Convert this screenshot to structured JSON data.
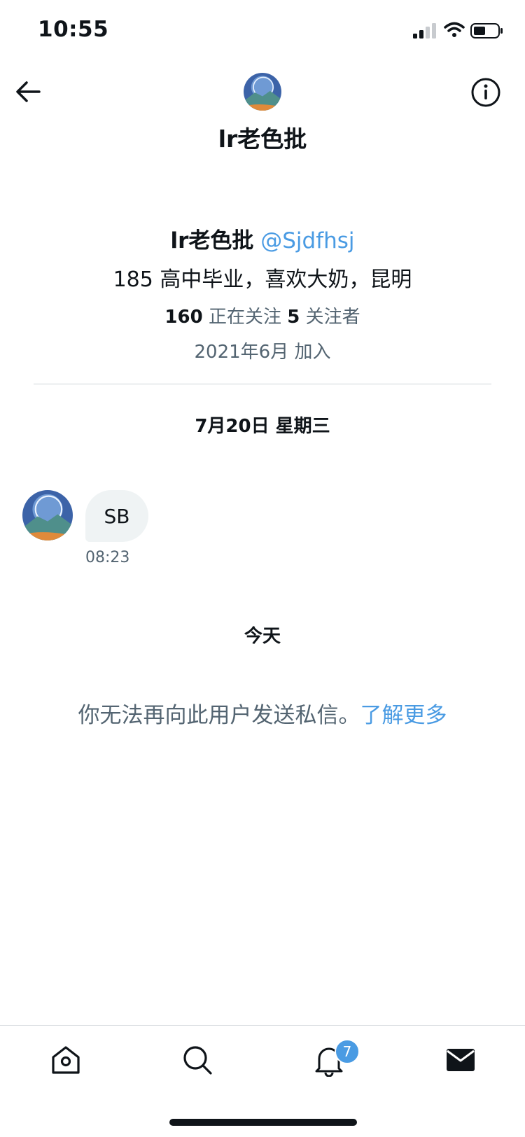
{
  "status_bar": {
    "time": "10:55"
  },
  "header": {
    "title": "lr老色批",
    "back_icon": "arrow-left-icon",
    "info_icon": "info-circle-icon"
  },
  "profile": {
    "name": "lr老色批",
    "handle": "@Sjdfhsj",
    "bio": "185 高中毕业，喜欢大奶，昆明",
    "following_count": "160",
    "following_label": "正在关注",
    "followers_count": "5",
    "followers_label": "关注者",
    "joined": "2021年6月 加入"
  },
  "conversation": {
    "date_label": "7月20日 星期三",
    "messages": [
      {
        "text": "SB",
        "time": "08:23"
      }
    ],
    "today_label": "今天",
    "notice_text": "你无法再向此用户发送私信。",
    "notice_link": "了解更多"
  },
  "bottom_nav": {
    "items": [
      "home-icon",
      "search-icon",
      "bell-icon",
      "mail-icon"
    ],
    "notification_badge": "7"
  },
  "colors": {
    "accent": "#4a9be3",
    "text": "#0f1419",
    "secondary": "#536471",
    "bubble": "#eff3f4"
  }
}
